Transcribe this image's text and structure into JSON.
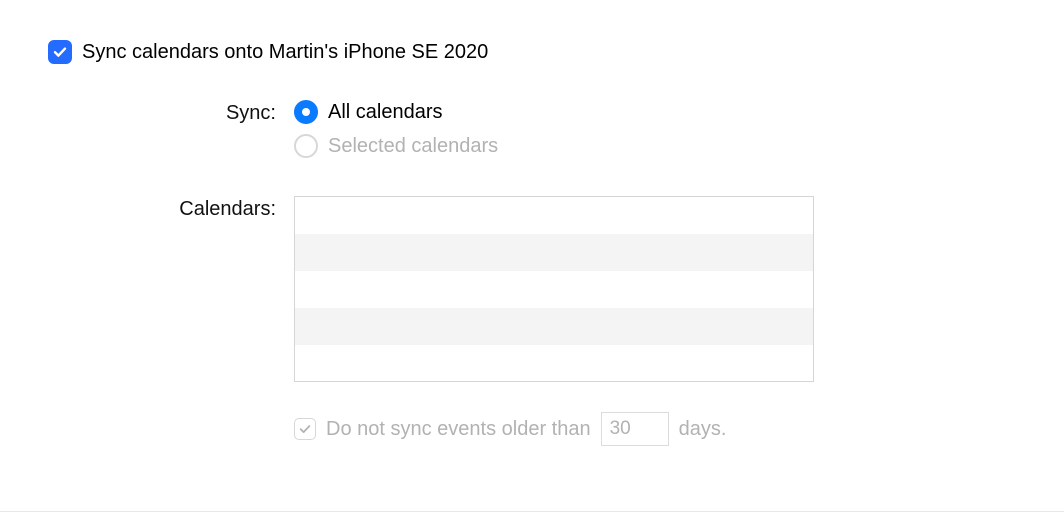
{
  "main": {
    "sync_checkbox_checked": true,
    "sync_label": "Sync calendars onto Martin's iPhone SE 2020"
  },
  "sync_mode": {
    "label": "Sync:",
    "options": [
      {
        "label": "All calendars",
        "selected": true
      },
      {
        "label": "Selected calendars",
        "selected": false
      }
    ]
  },
  "calendars_list": {
    "label": "Calendars:",
    "rows": [
      "",
      "",
      "",
      "",
      ""
    ]
  },
  "older": {
    "checkbox_checked": true,
    "prefix": "Do not sync events older than",
    "value": "30",
    "suffix": "days."
  },
  "colors": {
    "accent_blue": "#246CFF",
    "radio_blue": "#0a7aff",
    "disabled_text": "#b2b2b4"
  }
}
